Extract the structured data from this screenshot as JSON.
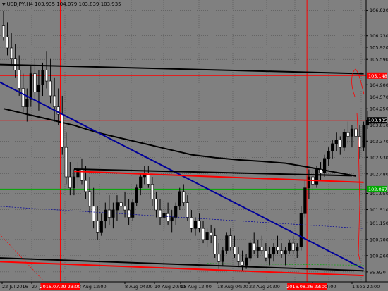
{
  "header": {
    "symbol": "USDJPY,H4",
    "ohlc": "103.935 104.079 103.839 103.935"
  },
  "colors": {
    "background": "#808080",
    "bull": "#000000",
    "bear": "#FFFFFF",
    "grid": "#000000",
    "resistance": "#FF0000",
    "support": "#00AA00",
    "trendline": "#000099",
    "moving_average": "#000000",
    "vline": "#FF0000"
  },
  "chart_data": {
    "type": "candlestick",
    "title": "USDJPY,H4",
    "ylim": [
      99.55,
      107.2
    ],
    "y_ticks": [
      106.92,
      106.23,
      105.92,
      105.59,
      104.9,
      104.57,
      104.25,
      103.81,
      103.37,
      102.93,
      102.48,
      101.95,
      101.51,
      101.15,
      100.7,
      100.26,
      99.82
    ],
    "x_ticks": [
      "22 Jul 2016",
      "27 Jul 2016",
      "3 Aug 12:00",
      "8 Aug 04:00",
      "10 Aug 20:00",
      "15 Aug 12:00",
      "18 Aug 04:00",
      "22 Aug 20:00",
      "Aug 04:00",
      "1 Sep 20:00"
    ],
    "highlighted_x_labels": [
      "2016.07.29 23:00",
      "2016.08.26 23:00"
    ],
    "price_labels": [
      {
        "value": 105.148,
        "label": "105.148",
        "color": "#FF0000"
      },
      {
        "value": 103.935,
        "label": "103.935",
        "color": "#000000"
      },
      {
        "value": 102.067,
        "label": "102.067",
        "color": "#00AA00"
      }
    ],
    "candles": [
      [
        106.5,
        106.9,
        106.1,
        106.2
      ],
      [
        106.2,
        106.6,
        105.7,
        105.9
      ],
      [
        105.9,
        106.3,
        105.4,
        105.6
      ],
      [
        105.6,
        106.0,
        105.1,
        105.3
      ],
      [
        105.3,
        105.7,
        104.6,
        104.8
      ],
      [
        104.8,
        105.2,
        104.1,
        104.3
      ],
      [
        104.3,
        104.8,
        103.9,
        104.5
      ],
      [
        104.5,
        105.4,
        104.3,
        105.2
      ],
      [
        105.2,
        105.6,
        104.5,
        104.7
      ],
      [
        104.7,
        105.3,
        104.2,
        104.9
      ],
      [
        104.9,
        105.5,
        104.6,
        105.3
      ],
      [
        105.3,
        105.8,
        104.8,
        105.0
      ],
      [
        105.0,
        105.6,
        104.4,
        104.6
      ],
      [
        104.6,
        105.1,
        103.9,
        104.3
      ],
      [
        104.3,
        104.8,
        103.8,
        104.1
      ],
      [
        104.1,
        104.6,
        103.0,
        103.2
      ],
      [
        103.2,
        103.6,
        102.2,
        102.4
      ],
      [
        102.4,
        102.8,
        101.9,
        102.1
      ],
      [
        102.1,
        102.6,
        101.9,
        102.4
      ],
      [
        102.4,
        102.8,
        102.1,
        102.6
      ],
      [
        102.6,
        102.9,
        102.2,
        102.3
      ],
      [
        102.3,
        102.7,
        101.8,
        102.0
      ],
      [
        102.0,
        102.4,
        101.4,
        101.6
      ],
      [
        101.6,
        102.1,
        101.0,
        101.2
      ],
      [
        101.2,
        101.6,
        100.7,
        100.9
      ],
      [
        100.9,
        101.4,
        100.8,
        101.2
      ],
      [
        101.2,
        101.7,
        101.0,
        101.5
      ],
      [
        101.5,
        101.9,
        101.1,
        101.3
      ],
      [
        101.3,
        101.7,
        101.0,
        101.5
      ],
      [
        101.5,
        101.9,
        101.2,
        101.7
      ],
      [
        101.7,
        102.0,
        101.4,
        101.6
      ],
      [
        101.6,
        102.0,
        101.3,
        101.5
      ],
      [
        101.5,
        101.8,
        101.1,
        101.3
      ],
      [
        101.3,
        101.8,
        101.2,
        101.7
      ],
      [
        101.7,
        102.2,
        101.6,
        102.1
      ],
      [
        102.1,
        102.5,
        101.9,
        102.4
      ],
      [
        102.4,
        102.7,
        102.2,
        102.5
      ],
      [
        102.5,
        102.7,
        102.1,
        102.2
      ],
      [
        102.2,
        102.4,
        101.6,
        101.8
      ],
      [
        101.8,
        102.0,
        101.3,
        101.5
      ],
      [
        101.5,
        101.8,
        101.1,
        101.3
      ],
      [
        101.3,
        101.6,
        101.0,
        101.4
      ],
      [
        101.4,
        101.7,
        101.1,
        101.2
      ],
      [
        101.2,
        101.5,
        100.9,
        101.3
      ],
      [
        101.3,
        101.7,
        101.1,
        101.6
      ],
      [
        101.6,
        102.1,
        101.5,
        102.0
      ],
      [
        102.0,
        102.2,
        101.6,
        101.7
      ],
      [
        101.7,
        101.9,
        101.2,
        101.3
      ],
      [
        101.3,
        101.5,
        100.9,
        101.0
      ],
      [
        101.0,
        101.3,
        100.8,
        101.2
      ],
      [
        101.2,
        101.4,
        100.9,
        101.0
      ],
      [
        101.0,
        101.2,
        100.6,
        100.7
      ],
      [
        100.7,
        101.0,
        100.5,
        100.9
      ],
      [
        100.9,
        101.1,
        100.6,
        100.8
      ],
      [
        100.8,
        101.0,
        100.2,
        100.3
      ],
      [
        100.3,
        100.6,
        99.9,
        100.1
      ],
      [
        100.1,
        100.5,
        100.0,
        100.4
      ],
      [
        100.4,
        100.9,
        100.3,
        100.8
      ],
      [
        100.8,
        101.0,
        100.4,
        100.5
      ],
      [
        100.5,
        100.8,
        100.2,
        100.3
      ],
      [
        100.3,
        100.5,
        99.95,
        100.1
      ],
      [
        100.1,
        100.4,
        99.85,
        100.0
      ],
      [
        100.0,
        100.3,
        99.9,
        100.2
      ],
      [
        100.2,
        100.7,
        100.1,
        100.6
      ],
      [
        100.6,
        100.9,
        100.3,
        100.4
      ],
      [
        100.4,
        100.7,
        100.2,
        100.5
      ],
      [
        100.5,
        100.8,
        100.3,
        100.4
      ],
      [
        100.4,
        100.6,
        100.1,
        100.2
      ],
      [
        100.2,
        100.5,
        100.0,
        100.3
      ],
      [
        100.3,
        100.6,
        100.1,
        100.5
      ],
      [
        100.5,
        100.8,
        100.3,
        100.4
      ],
      [
        100.4,
        100.6,
        100.2,
        100.3
      ],
      [
        100.3,
        100.5,
        100.0,
        100.4
      ],
      [
        100.4,
        100.7,
        100.3,
        100.6
      ],
      [
        100.6,
        100.8,
        100.3,
        100.4
      ],
      [
        100.4,
        100.6,
        100.2,
        100.5
      ],
      [
        100.5,
        101.6,
        100.4,
        101.4
      ],
      [
        101.4,
        102.3,
        101.3,
        102.1
      ],
      [
        102.1,
        102.6,
        101.8,
        102.4
      ],
      [
        102.4,
        102.6,
        102.0,
        102.2
      ],
      [
        102.2,
        102.7,
        102.1,
        102.6
      ],
      [
        102.6,
        102.8,
        102.3,
        102.5
      ],
      [
        102.5,
        103.0,
        102.4,
        102.9
      ],
      [
        102.9,
        103.2,
        102.7,
        103.1
      ],
      [
        103.1,
        103.4,
        102.9,
        103.3
      ],
      [
        103.3,
        103.6,
        103.1,
        103.4
      ],
      [
        103.4,
        103.5,
        103.0,
        103.2
      ],
      [
        103.2,
        103.7,
        103.1,
        103.6
      ],
      [
        103.6,
        103.9,
        103.3,
        103.5
      ],
      [
        103.5,
        103.8,
        103.2,
        103.7
      ],
      [
        103.7,
        104.0,
        103.4,
        103.5
      ],
      [
        103.5,
        103.8,
        102.9,
        103.2
      ],
      [
        103.2,
        103.9,
        103.1,
        103.8
      ],
      [
        103.8,
        104.2,
        103.7,
        103.935
      ]
    ],
    "moving_average": [
      [
        0,
        104.25
      ],
      [
        6,
        104.1
      ],
      [
        12,
        103.95
      ],
      [
        18,
        103.8
      ],
      [
        24,
        103.6
      ],
      [
        30,
        103.45
      ],
      [
        36,
        103.3
      ],
      [
        42,
        103.15
      ],
      [
        48,
        103.0
      ],
      [
        54,
        102.92
      ],
      [
        60,
        102.86
      ],
      [
        66,
        102.82
      ],
      [
        72,
        102.77
      ],
      [
        78,
        102.66
      ],
      [
        84,
        102.54
      ],
      [
        90,
        102.42
      ]
    ],
    "trendlines": [
      {
        "name": "blue-downtrend",
        "color": "#000099",
        "width": 2,
        "points": [
          [
            -1.5,
            105.0
          ],
          [
            92,
            99.9
          ]
        ]
      },
      {
        "name": "upper-channel",
        "color": "#000000",
        "width": 2,
        "points": [
          [
            -1.5,
            105.45
          ],
          [
            92,
            105.2
          ]
        ]
      },
      {
        "name": "resistance-black",
        "color": "#000000",
        "width": 2,
        "points": [
          [
            18,
            102.61
          ],
          [
            89,
            102.43
          ]
        ]
      },
      {
        "name": "resistance-red",
        "color": "#FF0000",
        "width": 2,
        "points": [
          [
            18,
            102.55
          ],
          [
            92,
            102.25
          ]
        ]
      },
      {
        "name": "bottom-black",
        "color": "#000000",
        "width": 2,
        "points": [
          [
            -1.5,
            100.2
          ],
          [
            92,
            99.85
          ]
        ]
      },
      {
        "name": "bottom-red",
        "color": "#FF0000",
        "width": 2,
        "points": [
          [
            -1.5,
            100.1
          ],
          [
            92,
            99.72
          ]
        ]
      },
      {
        "name": "dotted-blue",
        "color": "#000099",
        "width": 0.7,
        "dash": true,
        "points": [
          [
            -1.5,
            101.6
          ],
          [
            92,
            101.0
          ]
        ]
      },
      {
        "name": "dotted-red",
        "color": "#FF0000",
        "width": 0.7,
        "dash": true,
        "points": [
          [
            -1.5,
            100.9
          ],
          [
            10,
            99.6
          ]
        ]
      },
      {
        "name": "dotted-green",
        "color": "#00AA00",
        "width": 0.7,
        "dash": true,
        "points": [
          [
            52,
            100.05
          ],
          [
            92,
            100.0
          ]
        ]
      }
    ],
    "vertical_markers": [
      14.5,
      77.5
    ],
    "horizontal_levels": [
      {
        "value": 105.148,
        "color": "#FF0000"
      },
      {
        "value": 103.935,
        "color": "#FF0000"
      },
      {
        "value": 102.067,
        "color": "#00AA00"
      }
    ]
  }
}
